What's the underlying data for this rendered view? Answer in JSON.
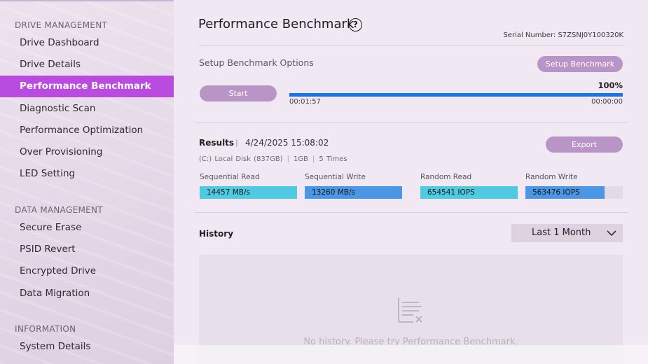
{
  "sidebar": {
    "sections": [
      {
        "label": "DRIVE MANAGEMENT"
      },
      {
        "label": "DATA MANAGEMENT"
      },
      {
        "label": "INFORMATION"
      }
    ],
    "items": [
      {
        "label": "Drive Dashboard"
      },
      {
        "label": "Drive Details"
      },
      {
        "label": "Performance Benchmark",
        "active": true
      },
      {
        "label": "Diagnostic Scan"
      },
      {
        "label": "Performance Optimization"
      },
      {
        "label": "Over Provisioning"
      },
      {
        "label": "LED Setting"
      },
      {
        "label": "Secure Erase"
      },
      {
        "label": "PSID Revert"
      },
      {
        "label": "Encrypted Drive"
      },
      {
        "label": "Data Migration"
      },
      {
        "label": "System Details"
      }
    ]
  },
  "header": {
    "title": "Performance Benchmark",
    "help_icon": "question-circle-icon",
    "serial": "Serial Number: S7ZSNJ0Y100320K"
  },
  "setup": {
    "label": "Setup Benchmark Options",
    "setup_button": "Setup Benchmark",
    "start_button": "Start",
    "progress_percent": 100,
    "progress_text": "100%",
    "elapsed": "00:01:57",
    "remaining": "00:00:00"
  },
  "results": {
    "label": "Results",
    "separator": "|",
    "datetime": "4/24/2025 15:08:02",
    "disk": "(C:) Local Disk (837GB)",
    "size": "1GB",
    "times": "5 Times",
    "export_button": "Export",
    "metrics": [
      {
        "label": "Sequential Read",
        "value": "14457 MB/s",
        "fill_fraction": 1.0,
        "color": "#4ecbe0"
      },
      {
        "label": "Sequential Write",
        "value": "13260 MB/s",
        "fill_fraction": 1.0,
        "color": "#4b97e6"
      },
      {
        "label": "Random Read",
        "value": "654541 IOPS",
        "fill_fraction": 1.0,
        "color": "#4ecbe0"
      },
      {
        "label": "Random Write",
        "value": "563476 IOPS",
        "fill_fraction": 0.81,
        "color": "#4b97e6"
      }
    ]
  },
  "history": {
    "label": "History",
    "dropdown_value": "Last 1 Month",
    "empty_icon": "clear-list-icon",
    "empty_text": "No history. Please try Performance Benchmark."
  },
  "colors": {
    "accent": "#b94cdf",
    "button": "#b895c6",
    "progress": "#1973e8"
  }
}
